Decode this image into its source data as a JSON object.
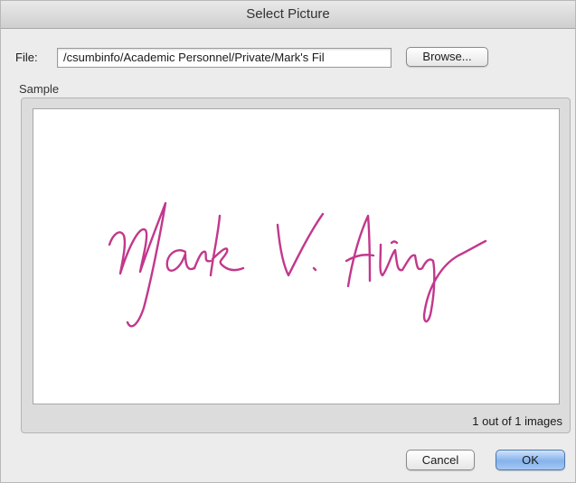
{
  "dialog": {
    "title": "Select Picture",
    "file_label": "File:",
    "file_path": "/csumbinfo/Academic Personnel/Private/Mark's Fil",
    "browse_label": "Browse...",
    "sample_label": "Sample",
    "image_count": "1 out of 1 images",
    "signature_text": "Mark V. Alabany",
    "cancel_label": "Cancel",
    "ok_label": "OK"
  },
  "colors": {
    "signature_ink": "#c2388c",
    "default_button": "#86b2ec"
  }
}
